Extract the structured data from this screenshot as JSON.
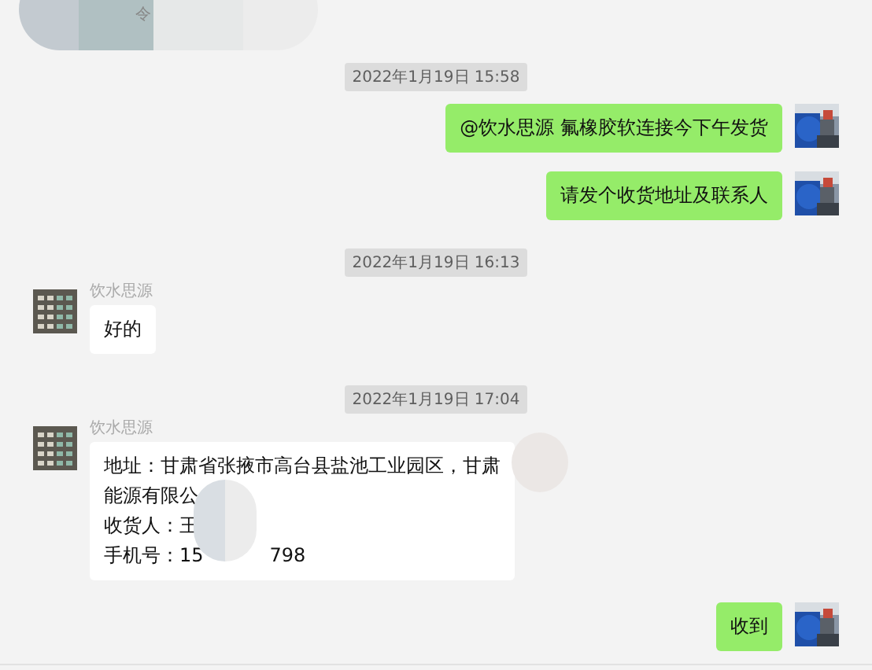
{
  "top_fragment": {
    "text": "令"
  },
  "messages": [
    {
      "kind": "timestamp",
      "text": "2022年1月19日 15:58"
    },
    {
      "kind": "outgoing",
      "lines": [
        "@饮水思源 氟橡胶软连接今下午发货"
      ]
    },
    {
      "kind": "outgoing",
      "lines": [
        "请发个收货地址及联系人"
      ]
    },
    {
      "kind": "timestamp",
      "text": "2022年1月19日 16:13"
    },
    {
      "kind": "incoming",
      "sender": "饮水思源",
      "lines": [
        "好的"
      ]
    },
    {
      "kind": "timestamp",
      "text": "2022年1月19日 17:04"
    },
    {
      "kind": "incoming",
      "sender": "饮水思源",
      "lines": [
        "地址：甘肃省张掖市高台县盐池工业园区，甘肃",
        "能源有限公",
        "收货人：王",
        "手机号：15"
      ],
      "tail": "798",
      "redacted": true
    },
    {
      "kind": "outgoing",
      "lines": [
        "收到"
      ]
    }
  ]
}
